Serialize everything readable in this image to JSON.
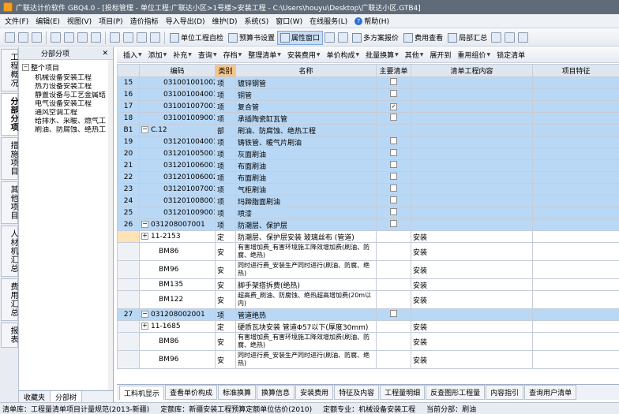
{
  "title": "广联达计价软件 GBQ4.0 - [投标管理 - 单位工程:广联达小区>1号楼>安装工程 - C:\\Users\\houyu\\Desktop\\广联达小区.GTB4]",
  "menu": [
    "文件(F)",
    "编辑(E)",
    "视图(V)",
    "项目(P)",
    "造价指标",
    "导入导出(D)",
    "维护(D)",
    "系统(S)",
    "窗口(W)",
    "在线服务(L)",
    "帮助(H)"
  ],
  "toolbar": {
    "unit_project": "单位工程自检",
    "budget_settings": "预算书设置",
    "property_window": "属性窗口",
    "multi_plan": "多方案报价",
    "fee_view": "费用查看",
    "local_summary": "局部汇总"
  },
  "left_tabs": [
    "工程概况",
    "分部分项",
    "措施项目",
    "其他项目",
    "人材机汇总",
    "费用汇总",
    "报表"
  ],
  "tree": {
    "header": "分部分项",
    "root": "整个项目",
    "items": [
      "机械设备安装工程",
      "热力设备安装工程",
      "静置设备与工艺金属结",
      "电气设备安装工程",
      "通风空调工程",
      "给排水、采暖、燃气工",
      "刷油、防腐蚀、绝热工"
    ],
    "bottom_tabs": [
      "收藏夹",
      "分部树"
    ]
  },
  "toolbar2": [
    "插入",
    "添加",
    "补充",
    "查询",
    "存档",
    "整理清单",
    "安装费用",
    "单价构成",
    "批量换算",
    "其他",
    "展开到",
    "重用组价",
    "锁定清单"
  ],
  "columns": [
    "编码",
    "类别",
    "名称",
    "主要清单",
    "清单工程内容",
    "项目特征"
  ],
  "rows": [
    {
      "rn": "15",
      "code": "031001001002",
      "type": "项",
      "name": "镀锌钢管",
      "main": false,
      "content": "",
      "style": "blue"
    },
    {
      "rn": "16",
      "code": "031001004001",
      "type": "项",
      "name": "铜管",
      "main": false,
      "content": "",
      "style": "blue"
    },
    {
      "rn": "17",
      "code": "031001007001",
      "type": "项",
      "name": "复合管",
      "main": true,
      "content": "",
      "style": "blue"
    },
    {
      "rn": "18",
      "code": "031001009001",
      "type": "项",
      "name": "承插陶瓷缸瓦管",
      "main": false,
      "content": "",
      "style": "blue"
    },
    {
      "rn": "B1",
      "code": "C.12",
      "type": "部",
      "name": "刷油、防腐蚀、绝热工程",
      "main": null,
      "content": "",
      "style": "section"
    },
    {
      "rn": "19",
      "code": "031201004001",
      "type": "项",
      "name": "铸铁管、暖气片刷油",
      "main": false,
      "content": "",
      "style": "blue"
    },
    {
      "rn": "20",
      "code": "031201005001",
      "type": "项",
      "name": "灰面刷油",
      "main": false,
      "content": "",
      "style": "blue"
    },
    {
      "rn": "21",
      "code": "031201006001",
      "type": "项",
      "name": "布面刷油",
      "main": false,
      "content": "",
      "style": "blue"
    },
    {
      "rn": "22",
      "code": "031201006002",
      "type": "项",
      "name": "布面刷油",
      "main": false,
      "content": "",
      "style": "blue"
    },
    {
      "rn": "23",
      "code": "031201007001",
      "type": "项",
      "name": "气柜刷油",
      "main": false,
      "content": "",
      "style": "blue"
    },
    {
      "rn": "24",
      "code": "031201008001",
      "type": "项",
      "name": "玛蹄脂面刷油",
      "main": false,
      "content": "",
      "style": "blue"
    },
    {
      "rn": "25",
      "code": "031201009001",
      "type": "项",
      "name": "喷漆",
      "main": false,
      "content": "",
      "style": "blue"
    },
    {
      "rn": "26",
      "code": "031208007001",
      "type": "项",
      "name": "防潮层、保护层",
      "main": false,
      "content": "",
      "style": "blue"
    },
    {
      "rn": "",
      "code": "11-2153",
      "type": "定",
      "name": "防潮层、保护层安装 玻璃丝布 (管道)",
      "main": null,
      "content": "安装",
      "style": "yel"
    },
    {
      "rn": "",
      "code": "BM86",
      "type": "安",
      "name": "有害增加费_有害环境施工降效增加费(刷油、防腐、绝热)",
      "main": null,
      "content": "安装",
      "style": "tall"
    },
    {
      "rn": "",
      "code": "BM96",
      "type": "安",
      "name": "同时进行费_安装生产同时进行(刷油、防腐、绝热)",
      "main": null,
      "content": "安装",
      "style": "tall"
    },
    {
      "rn": "",
      "code": "BM135",
      "type": "安",
      "name": "脚手架搭拆费(绝热)",
      "main": null,
      "content": "安装",
      "style": ""
    },
    {
      "rn": "",
      "code": "BM122",
      "type": "安",
      "name": "超高费_刷油、防腐蚀、绝热超高增加费(20m以内)",
      "main": null,
      "content": "安装",
      "style": "tall"
    },
    {
      "rn": "27",
      "code": "031208002001",
      "type": "项",
      "name": "管道绝热",
      "main": false,
      "content": "",
      "style": "blue"
    },
    {
      "rn": "",
      "code": "11-1685",
      "type": "定",
      "name": "硬质瓦块安装 管道Φ57以下(厚度30mm)",
      "main": null,
      "content": "安装",
      "style": ""
    },
    {
      "rn": "",
      "code": "BM86",
      "type": "安",
      "name": "有害增加费_有害环境施工降效增加费(刷油、防腐、绝热)",
      "main": null,
      "content": "安装",
      "style": "tall"
    },
    {
      "rn": "",
      "code": "BM96",
      "type": "安",
      "name": "同时进行费_安装生产同时进行(刷油、防腐、绝热)",
      "main": null,
      "content": "安装",
      "style": "tall"
    }
  ],
  "bottom_tabs": [
    "工料机显示",
    "查看单价构成",
    "标准换算",
    "换算信息",
    "安装费用",
    "特征及内容",
    "工程量明细",
    "反查图形工程量",
    "内容指引",
    "查询用户清单"
  ],
  "status": {
    "list": "清单库：工程量清单项目计量规范(2013-新疆)",
    "quota": "定额库：新疆安装工程预算定额单位估价(2010)",
    "major": "定额专业：机械设备安装工程",
    "current": "当前分部：刷油"
  }
}
